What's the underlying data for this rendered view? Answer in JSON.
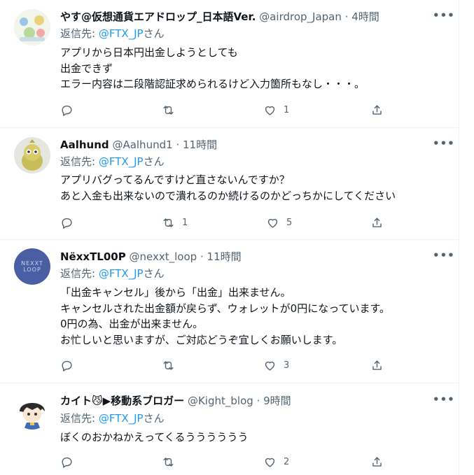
{
  "tweets": [
    {
      "name": "やす@仮想通貨エアドロップ_日本語Ver.",
      "handle": "@airdrop_Japan",
      "dot": "·",
      "time": "4時間",
      "reply_label": "返信先: ",
      "reply_to": "@FTX_JP",
      "reply_suffix": "さん",
      "lines": [
        "アプリから日本円出金しようとしても",
        "出金できず",
        "エラー内容は二段階認証求められるけど入力箇所もなし・・・。"
      ],
      "reply_count": "",
      "retweet_count": "",
      "like_count": "1",
      "more": "•••"
    },
    {
      "name": "Aalhund",
      "handle": "@Aalhund1",
      "dot": "·",
      "time": "11時間",
      "reply_label": "返信先: ",
      "reply_to": "@FTX_JP",
      "reply_suffix": "さん",
      "lines": [
        "アプリバグってるんですけど直さないんですか？",
        "あと入金も出来ないので潰れるのか続けるのかどっちかにしてください"
      ],
      "reply_count": "",
      "retweet_count": "1",
      "like_count": "5",
      "more": "•••"
    },
    {
      "name": "NëxxTL00P",
      "handle": "@nexxt_loop",
      "dot": "·",
      "time": "11時間",
      "reply_label": "返信先: ",
      "reply_to": "@FTX_JP",
      "reply_suffix": "さん",
      "avatar_text": "NEXXT\nLOOP",
      "lines": [
        "「出金キャンセル」後から「出金」出来ません。",
        "キャンセルされた出金額が戻らず、ウォレットが0円になっています。",
        "0円の為、出金が出来ません。",
        "お忙しいと思いますが、ご対応どうぞ宜しくお願いします。"
      ],
      "reply_count": "",
      "retweet_count": "",
      "like_count": "3",
      "more": "•••"
    },
    {
      "name": "カイト😼▶移動系ブロガー",
      "handle": "@Kight_blog",
      "dot": "·",
      "time": "9時間",
      "reply_label": "返信先: ",
      "reply_to": "@FTX_JP",
      "reply_suffix": "さん",
      "lines": [
        "ぼくのおかねかえってくるうううううう"
      ],
      "reply_count": "",
      "retweet_count": "",
      "like_count": "2",
      "more": "•••"
    }
  ],
  "icons": {
    "reply": "reply-icon",
    "retweet": "retweet-icon",
    "like": "like-icon",
    "share": "share-icon",
    "more": "more-icon"
  },
  "colors": {
    "link": "#1d9bf0",
    "secondary_text": "#536471",
    "primary_text": "#0f1419",
    "divider": "#eff3f4",
    "nexxt_avatar_bg": "#4a5fa3"
  }
}
